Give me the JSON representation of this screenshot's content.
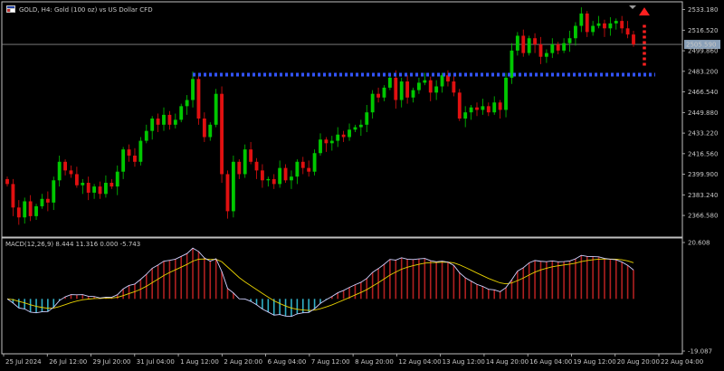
{
  "header": {
    "symbol_title": "GOLD, H4:  Gold (100 oz) vs US Dollar CFD",
    "window_icon": "chart-window-icon"
  },
  "colors": {
    "background": "#000000",
    "bull": "#00c800",
    "bear": "#e01010",
    "grid_frame": "#c0c0c0",
    "resistance": "#3355ff",
    "arrow": "#ff2020",
    "macd_line": "#d0d0ff",
    "signal_line": "#e8d200",
    "hist_pos": "#b02020",
    "hist_neg": "#30b0c8",
    "price_tag_bg": "#8aa0b8"
  },
  "chart_data": [
    {
      "type": "candlestick",
      "ylim": [
        2352,
        2538
      ],
      "yticks": [
        "2533.180",
        "2516.520",
        "2499.860",
        "2483.200",
        "2466.540",
        "2449.880",
        "2433.220",
        "2416.560",
        "2399.900",
        "2383.240",
        "2366.580"
      ],
      "current_price": 2505,
      "current_price_label": "2505.590",
      "resistance_level": 2480.5,
      "resistance_start_index": 32,
      "annotation": "dotted red arrow pointing up",
      "xtick_labels": [
        "25 Jul 2024",
        "26 Jul 12:00",
        "29 Jul 20:00",
        "31 Jul 04:00",
        "1 Aug 12:00",
        "2 Aug 20:00",
        "6 Aug 04:00",
        "7 Aug 12:00",
        "8 Aug 20:00",
        "12 Aug 04:00",
        "13 Aug 12:00",
        "14 Aug 20:00",
        "16 Aug 04:00",
        "19 Aug 12:00",
        "20 Aug 20:00",
        "22 Aug 04:00"
      ],
      "closes": [
        2392,
        2373,
        2365,
        2378,
        2366,
        2374,
        2380,
        2377,
        2395,
        2410,
        2403,
        2400,
        2391,
        2393,
        2385,
        2390,
        2384,
        2393,
        2390,
        2402,
        2420,
        2415,
        2410,
        2427,
        2435,
        2445,
        2440,
        2448,
        2440,
        2444,
        2455,
        2460,
        2477,
        2445,
        2430,
        2440,
        2465,
        2400,
        2370,
        2410,
        2400,
        2420,
        2410,
        2403,
        2395,
        2396,
        2392,
        2405,
        2395,
        2398,
        2410,
        2405,
        2402,
        2417,
        2428,
        2425,
        2427,
        2432,
        2430,
        2436,
        2438,
        2440,
        2450,
        2465,
        2462,
        2470,
        2478,
        2460,
        2475,
        2462,
        2468,
        2474,
        2476,
        2466,
        2471,
        2480,
        2475,
        2466,
        2445,
        2450,
        2454,
        2452,
        2455,
        2450,
        2458,
        2452,
        2478,
        2500,
        2512,
        2498,
        2510,
        2505,
        2495,
        2498,
        2505,
        2500,
        2506,
        2510,
        2520,
        2530,
        2515,
        2520,
        2522,
        2518,
        2522,
        2524,
        2518,
        2513,
        2505
      ],
      "opens_note": "each candle opens at previous close"
    },
    {
      "type": "macd-histogram",
      "title": "MACD(12,26,9) 8.444 11.316 0.000 -5.743",
      "ylim": [
        -19.087,
        20.608
      ],
      "yticks": [
        "20.608",
        "-19.087"
      ]
    }
  ]
}
